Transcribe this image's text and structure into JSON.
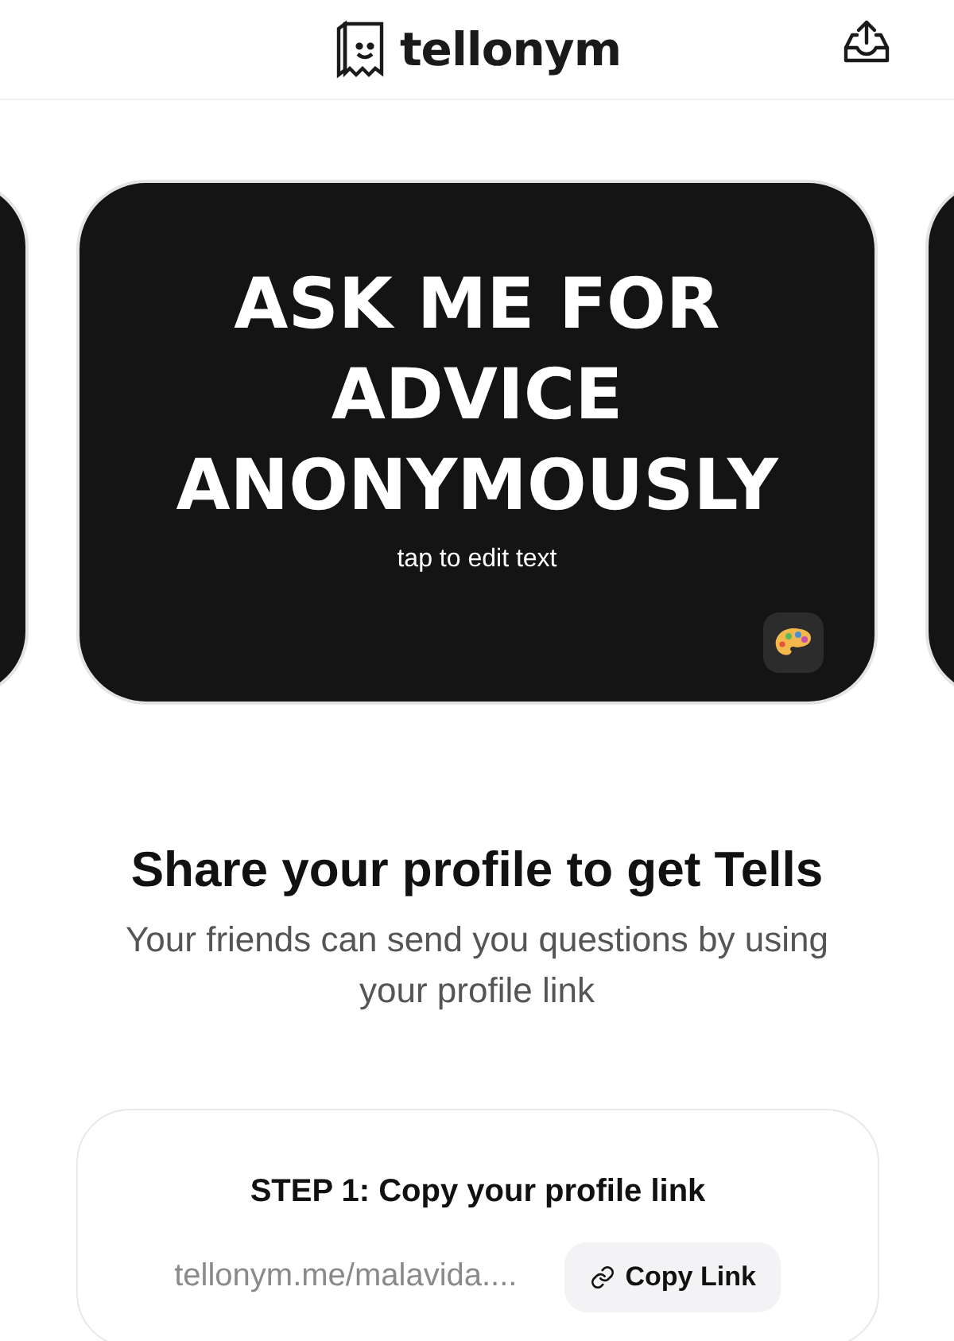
{
  "header": {
    "brand": "tellonym"
  },
  "card": {
    "headline": "ASK ME FOR ADVICE ANONYMOUSLY",
    "hint": "tap to edit text"
  },
  "share": {
    "title": "Share your profile to get Tells",
    "subtitle": "Your friends can send you questions by using your profile link"
  },
  "step": {
    "title": "STEP 1: Copy your profile link",
    "link": "tellonym.me/malavida....",
    "button": "Copy Link"
  }
}
